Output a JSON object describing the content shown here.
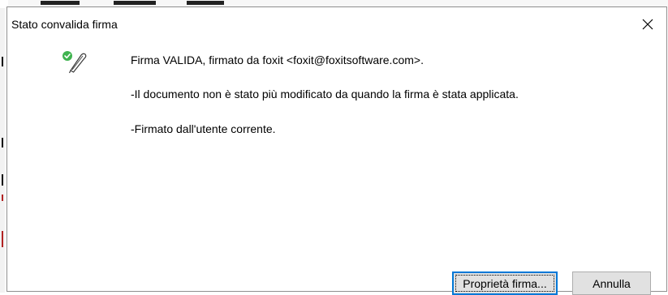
{
  "dialog": {
    "title": "Stato convalida firma",
    "close_glyph": "×",
    "status_icon": "valid-signature-icon",
    "messages": [
      "Firma VALIDA, firmato da foxit <foxit@foxitsoftware.com>.",
      "-Il documento non è stato più modificato da quando la firma è stata applicata.",
      "-Firmato dall'utente corrente."
    ],
    "buttons": {
      "properties_label": "Proprietà firma...",
      "cancel_label": "Annulla"
    }
  },
  "colors": {
    "check_green": "#3fb34f",
    "focus_blue": "#0078d7",
    "button_face": "#e1e1e1"
  }
}
